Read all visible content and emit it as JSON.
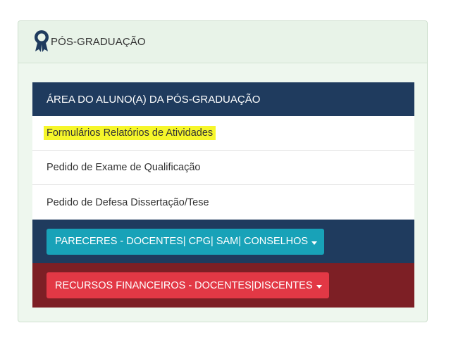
{
  "panel": {
    "title": "PÓS-GRADUAÇÃO",
    "icon": "award-ribbon-icon"
  },
  "menu": {
    "header": "ÁREA DO ALUNO(A) DA PÓS-GRADUAÇÃO",
    "items": [
      {
        "label": "Formulários Relatórios de Atividades",
        "highlighted": true
      },
      {
        "label": "Pedido de Exame de Qualificação"
      },
      {
        "label": "Pedido de Defesa Dissertação/Tese"
      }
    ]
  },
  "buttons": {
    "pareceres": "PARECERES - DOCENTES| CPG| SAM| CONSELHOS",
    "recursos": "RECURSOS FINANCEIROS - DOCENTES|DISCENTES"
  },
  "colors": {
    "header_navy": "#1f3b5e",
    "band_red": "#7d1f25",
    "button_teal": "#18a2b8",
    "button_red": "#e23845",
    "highlight_yellow": "#f6f62a",
    "panel_bg": "#eef7ee"
  }
}
